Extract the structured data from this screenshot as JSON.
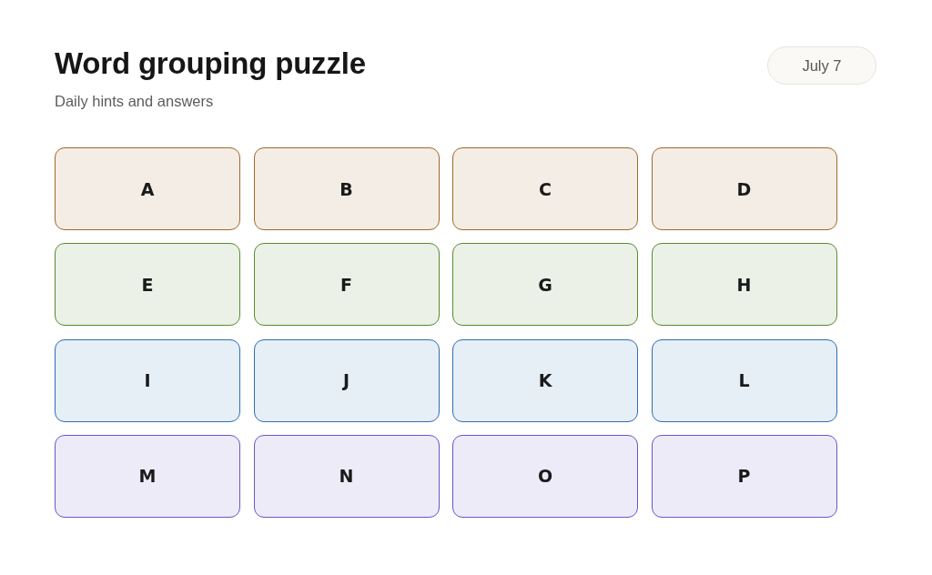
{
  "header": {
    "title": "Word grouping puzzle",
    "subtitle": "Daily hints and answers",
    "date": "July 7"
  },
  "groups": [
    {
      "color": "#a0692a",
      "tiles": [
        "A",
        "B",
        "C",
        "D"
      ]
    },
    {
      "color": "#5a8a2e",
      "tiles": [
        "E",
        "F",
        "G",
        "H"
      ]
    },
    {
      "color": "#2f6eb3",
      "tiles": [
        "I",
        "J",
        "K",
        "L"
      ]
    },
    {
      "color": "#6a57c2",
      "tiles": [
        "M",
        "N",
        "O",
        "P"
      ]
    }
  ]
}
